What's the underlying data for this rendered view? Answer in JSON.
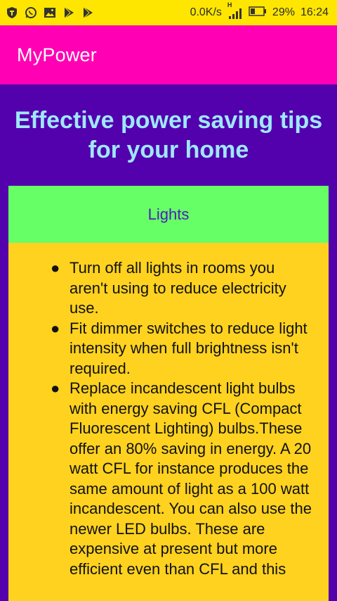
{
  "status_bar": {
    "left_icons": [
      "shield-icon",
      "whatsapp-icon",
      "image-icon",
      "play-store-icon",
      "play-store-icon"
    ],
    "network_speed": "0.0K/s",
    "signal_label": "H",
    "battery_percent": "29%",
    "time": "16:24",
    "background": "#ffe600"
  },
  "app_bar": {
    "title": "MyPower",
    "background": "#ff00b4"
  },
  "main": {
    "headline_line1": "Effective power saving tips",
    "headline_line2": "for your home",
    "section": {
      "title": "Lights",
      "tips": [
        "Turn off all lights in rooms you aren't using to reduce electricity use.",
        "Fit dimmer switches to reduce light intensity when full brightness isn't required.",
        "Replace incandescent light bulbs with energy saving CFL (Compact Fluorescent Lighting) bulbs.These offer an 80% saving in energy. A 20 watt CFL for instance produces the same amount of light as a 100 watt incandescent. You can also use the newer LED bulbs. These are expensive at present but more efficient even than CFL and this"
      ]
    },
    "colors": {
      "background": "#5300ad",
      "headline": "#9fe7ff",
      "section_header": "#66ff66",
      "section_body": "#ffd21f"
    }
  }
}
